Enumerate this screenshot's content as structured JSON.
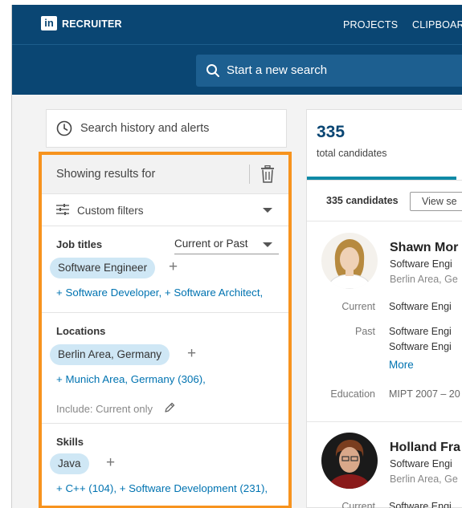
{
  "header": {
    "logo": "in",
    "brand": "RECRUITER",
    "nav": [
      {
        "label": "PROJECTS"
      },
      {
        "label": "CLIPBOARD"
      }
    ],
    "search_placeholder": "Start a new search"
  },
  "sidebar": {
    "history_label": "Search history and alerts",
    "showing_label": "Showing results for",
    "custom_filters_label": "Custom filters",
    "job_titles": {
      "title": "Job titles",
      "scope": "Current or Past",
      "selected": "Software Engineer",
      "suggestions": "+ Software Developer,  + Software Architect,"
    },
    "locations": {
      "title": "Locations",
      "selected": "Berlin Area, Germany",
      "suggestions": "+ Munich Area, Germany (306),",
      "include": "Include: Current only"
    },
    "skills": {
      "title": "Skills",
      "selected": "Java",
      "suggestions": "+ C++ (104),  + Software Development (231),"
    }
  },
  "results": {
    "total_count": "335",
    "total_label": "total candidates",
    "count_label": "335 candidates",
    "view_button": "View se",
    "candidates": [
      {
        "name": "Shawn Mor",
        "headline": "Software Engi",
        "location": "Berlin Area, Ge",
        "current_label": "Current",
        "current": "Software Engi",
        "past_label": "Past",
        "past": [
          "Software Engi",
          "Software Engi"
        ],
        "more": "More",
        "education_label": "Education",
        "education": "MIPT  2007 – 20"
      },
      {
        "name": "Holland Fra",
        "headline": "Software Engi",
        "location": "Berlin Area, Ge",
        "current_label": "Current",
        "current": "Software Engi"
      }
    ]
  },
  "colors": {
    "header": "#0a4673",
    "highlight_border": "#f7931e",
    "pill": "#cfe7f5",
    "link": "#0073b1",
    "tab_underline": "#0f8aa6"
  }
}
